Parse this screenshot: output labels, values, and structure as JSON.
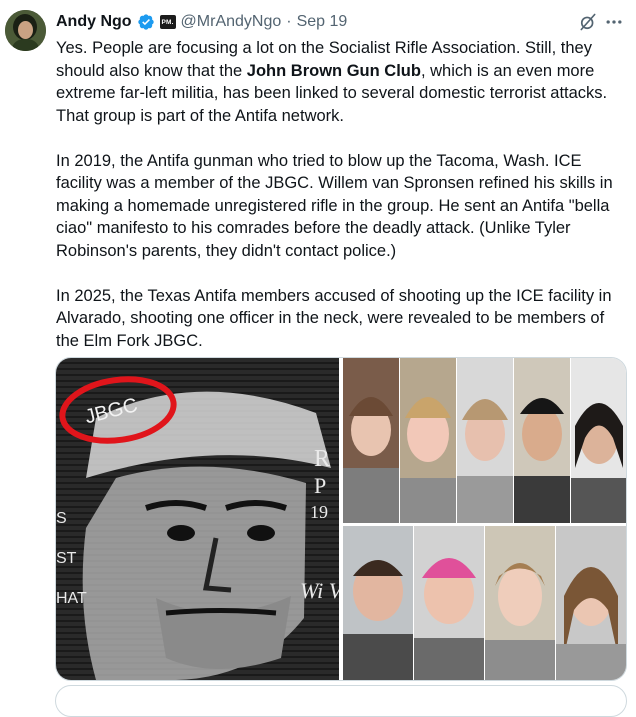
{
  "tweet": {
    "author_name": "Andy Ngo",
    "affiliate_badge": "PM.",
    "handle": "@MrAndyNgo",
    "separator": "·",
    "date": "Sep 19",
    "paragraphs": [
      {
        "pre": "Yes. People are focusing a lot on the Socialist Rifle Association. Still, they should also know that the ",
        "bold": "John Brown Gun Club",
        "post": ", which is an even more extreme far-left militia, has been linked to several domestic terrorist attacks. That group is part of the Antifa network."
      },
      {
        "text": "In 2019, the Antifa gunman who tried to blow up the Tacoma, Wash. ICE facility was a member of the JBGC. Willem van Spronsen refined his skills in making a homemade unregistered rifle in the group. He sent an Antifa \"bella ciao\" manifesto to his comrades before the deadly attack. (Unlike Tyler Robinson's parents, they didn't contact police.)"
      },
      {
        "text": "In 2025, the Texas Antifa members accused of shooting up the ICE facility in Alvarado, shooting one officer in the neck, were revealed to be members of the Elm Fork JBGC."
      }
    ]
  },
  "media": {
    "mural_text": {
      "circled": "JBGC",
      "right_lines": [
        "R",
        "P",
        "19"
      ],
      "left_lines": [
        "S",
        "ST",
        "HAT"
      ],
      "signature": "Wi Von"
    },
    "mugshot_rows": [
      5,
      4
    ]
  },
  "icons": [
    "verified-badge-icon",
    "grok-icon",
    "more-icon"
  ],
  "colors": {
    "text": "#0f1419",
    "secondary": "#536471",
    "verified": "#1d9bf0",
    "border": "#cfd9de",
    "circle_annotation": "#e0151b"
  }
}
